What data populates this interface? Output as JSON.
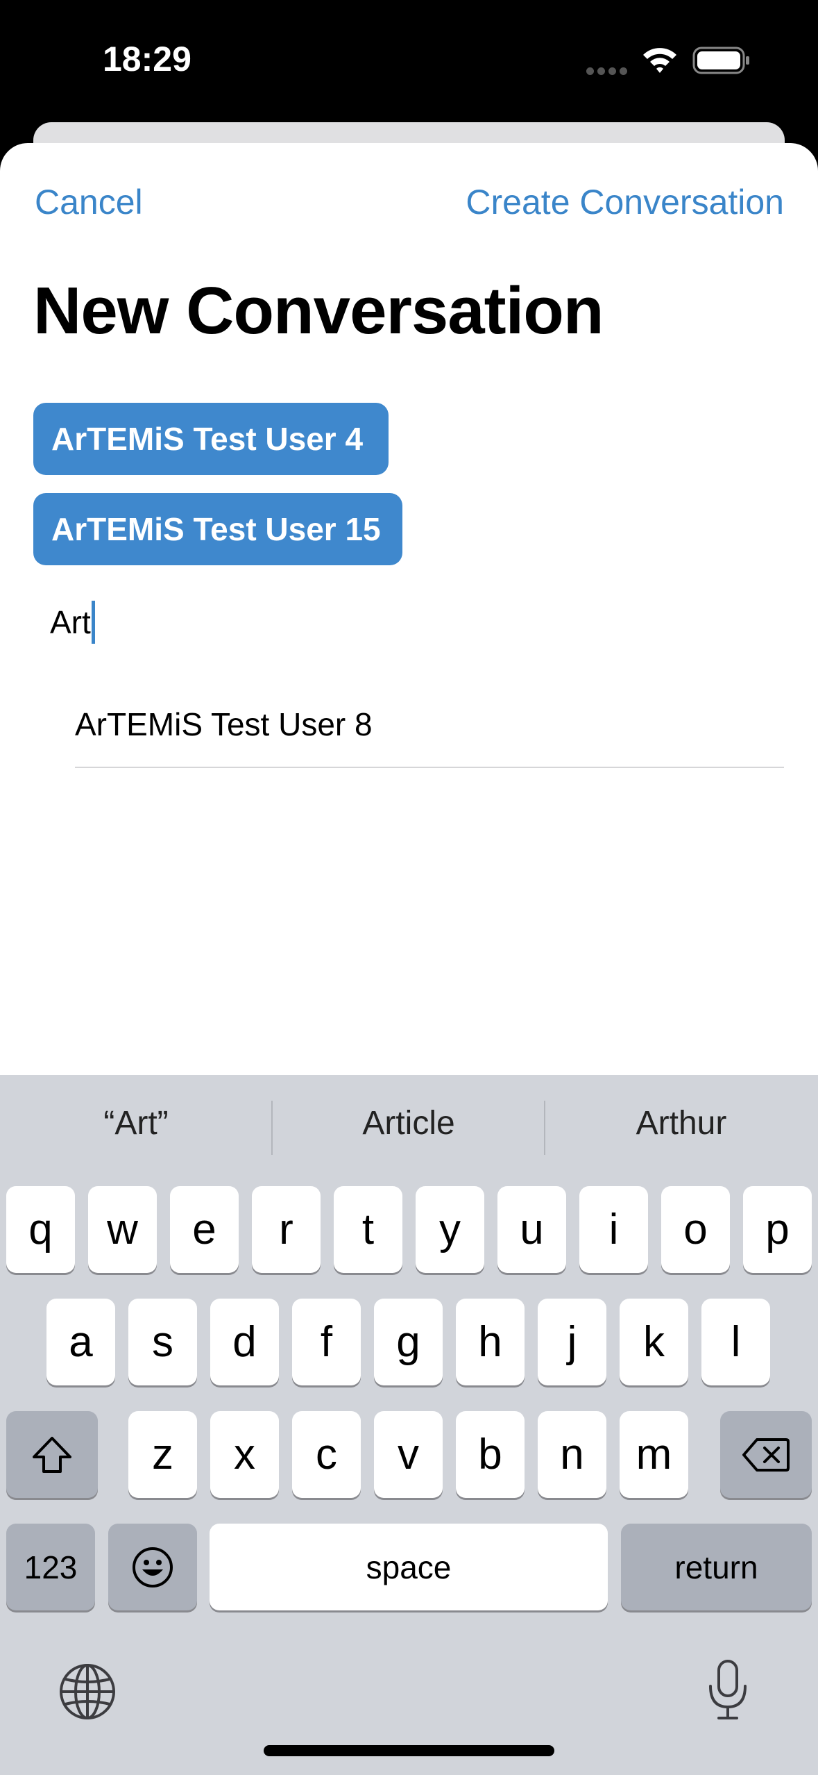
{
  "status_bar": {
    "time": "18:29"
  },
  "nav": {
    "cancel_label": "Cancel",
    "create_label": "Create Conversation"
  },
  "title": "New Conversation",
  "selected_users": [
    "ArTEMiS Test User 4",
    "ArTEMiS Test User 15"
  ],
  "search": {
    "value": "Art"
  },
  "suggestions": [
    "ArTEMiS Test User 8"
  ],
  "keyboard": {
    "predictions": [
      "“Art”",
      "Article",
      "Arthur"
    ],
    "row1": [
      "q",
      "w",
      "e",
      "r",
      "t",
      "y",
      "u",
      "i",
      "o",
      "p"
    ],
    "row2": [
      "a",
      "s",
      "d",
      "f",
      "g",
      "h",
      "j",
      "k",
      "l"
    ],
    "row3": [
      "z",
      "x",
      "c",
      "v",
      "b",
      "n",
      "m"
    ],
    "numbers_label": "123",
    "space_label": "space",
    "return_label": "return"
  },
  "colors": {
    "accent": "#3a85c9",
    "chip": "#3f88cd",
    "keyboard_bg": "#d1d4da"
  }
}
